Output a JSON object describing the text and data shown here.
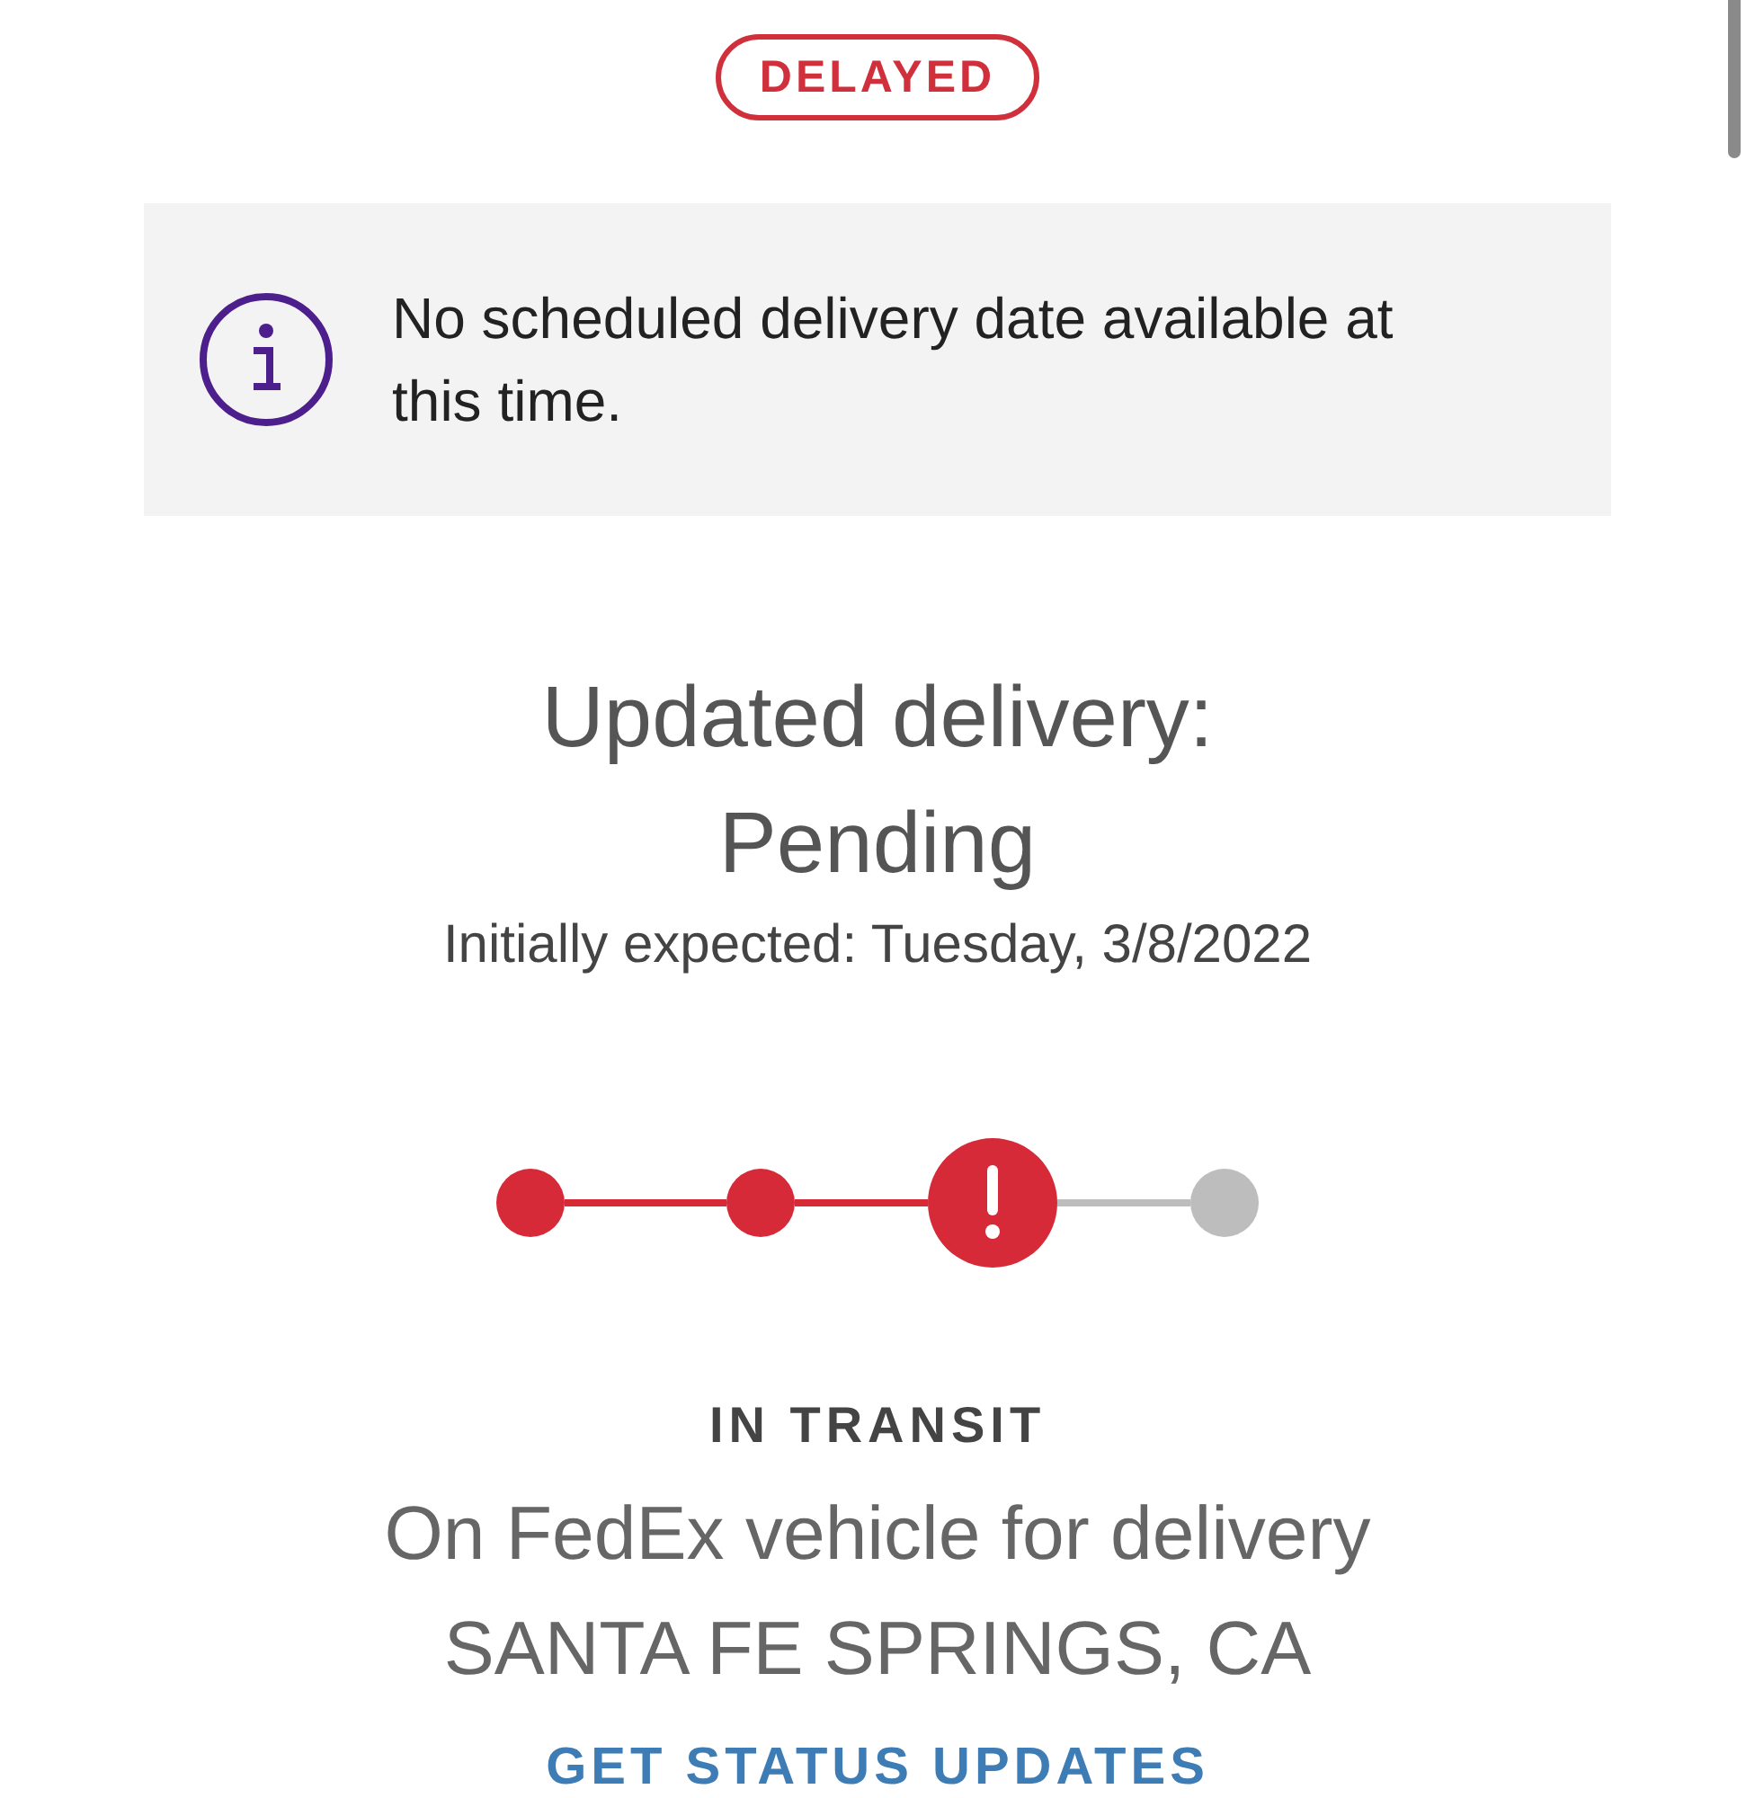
{
  "status_badge": "DELAYED",
  "notice": {
    "text": "No scheduled delivery date available at this time."
  },
  "delivery": {
    "heading_line_1": "Updated delivery:",
    "heading_line_2": "Pending",
    "initial": "Initially expected: Tuesday, 3/8/2022"
  },
  "progress": [
    {
      "kind": "done"
    },
    {
      "kind": "done"
    },
    {
      "kind": "alert"
    },
    {
      "kind": "pending"
    }
  ],
  "status": {
    "label": "IN TRANSIT",
    "detail": "On FedEx vehicle for delivery",
    "location": "SANTA FE SPRINGS, CA"
  },
  "link": "GET STATUS UPDATES"
}
